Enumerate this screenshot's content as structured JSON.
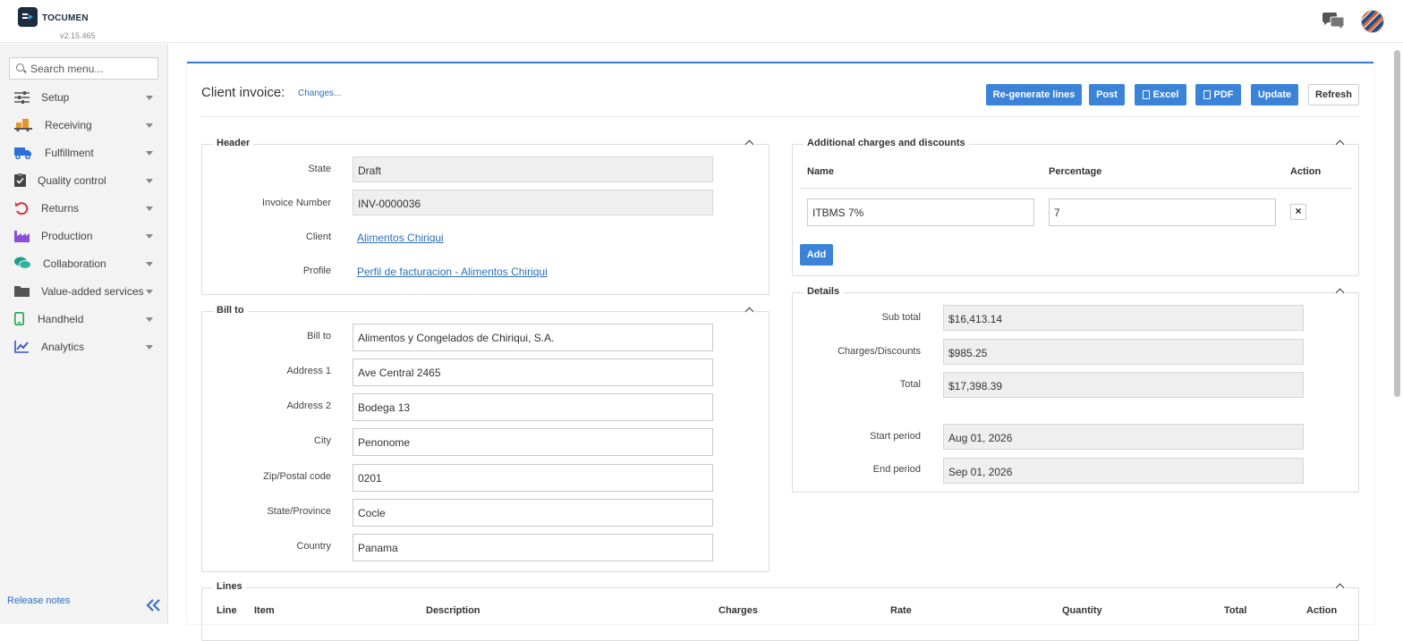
{
  "app": {
    "brand": "TOCUMEN",
    "version": "v2.15.465"
  },
  "sidebar": {
    "search_placeholder": "Search menu...",
    "items": [
      {
        "label": "Setup",
        "icon": "sliders-icon",
        "color": "#555555"
      },
      {
        "label": "Receiving",
        "icon": "truck-boxes-icon",
        "color": "#e8952a"
      },
      {
        "label": "Fulfillment",
        "icon": "delivery-truck-icon",
        "color": "#2d6fd8"
      },
      {
        "label": "Quality control",
        "icon": "clipboard-check-icon",
        "color": "#444444"
      },
      {
        "label": "Returns",
        "icon": "undo-icon",
        "color": "#d63232"
      },
      {
        "label": "Production",
        "icon": "factory-icon",
        "color": "#8a4fd8"
      },
      {
        "label": "Collaboration",
        "icon": "chat-bubbles-icon",
        "color": "#1f9e8a"
      },
      {
        "label": "Value-added services",
        "icon": "folder-icon",
        "color": "#555555"
      },
      {
        "label": "Handheld",
        "icon": "mobile-icon",
        "color": "#1fa64a"
      },
      {
        "label": "Analytics",
        "icon": "line-chart-icon",
        "color": "#3a4fc8"
      }
    ],
    "release_notes": "Release notes"
  },
  "page": {
    "title": "Client invoice:",
    "changes_link": "Changes...",
    "buttons": {
      "regenerate": "Re-generate lines",
      "post": "Post",
      "excel": "Excel",
      "pdf": "PDF",
      "update": "Update",
      "refresh": "Refresh"
    }
  },
  "header_panel": {
    "legend": "Header",
    "state_label": "State",
    "state_value": "Draft",
    "invoice_label": "Invoice Number",
    "invoice_value": "INV-0000036",
    "client_label": "Client",
    "client_value": "Alimentos Chiriqui",
    "profile_label": "Profile",
    "profile_value": "Perfil de facturacion - Alimentos Chiriqui"
  },
  "bill_to_panel": {
    "legend": "Bill to",
    "fields": [
      {
        "label": "Bill to",
        "value": "Alimentos y Congelados de Chiriqui, S.A."
      },
      {
        "label": "Address 1",
        "value": "Ave Central 2465"
      },
      {
        "label": "Address 2",
        "value": "Bodega 13"
      },
      {
        "label": "City",
        "value": "Penonome"
      },
      {
        "label": "Zip/Postal code",
        "value": "0201"
      },
      {
        "label": "State/Province",
        "value": "Cocle"
      },
      {
        "label": "Country",
        "value": "Panama"
      }
    ]
  },
  "charges_panel": {
    "legend": "Additional charges and discounts",
    "col_name": "Name",
    "col_percentage": "Percentage",
    "col_action": "Action",
    "row_name": "ITBMS 7%",
    "row_percentage": "7",
    "remove_symbol": "×",
    "add_button": "Add"
  },
  "details_panel": {
    "legend": "Details",
    "subtotal_label": "Sub total",
    "subtotal_value": "$16,413.14",
    "charges_label": "Charges/Discounts",
    "charges_value": "$985.25",
    "total_label": "Total",
    "total_value": "$17,398.39",
    "start_label": "Start period",
    "start_value": "Aug 01, 2026",
    "end_label": "End period",
    "end_value": "Sep 01, 2026"
  },
  "lines_panel": {
    "legend": "Lines",
    "columns": [
      "Line",
      "Item",
      "Description",
      "Charges",
      "Rate",
      "Quantity",
      "Total",
      "Action"
    ]
  }
}
